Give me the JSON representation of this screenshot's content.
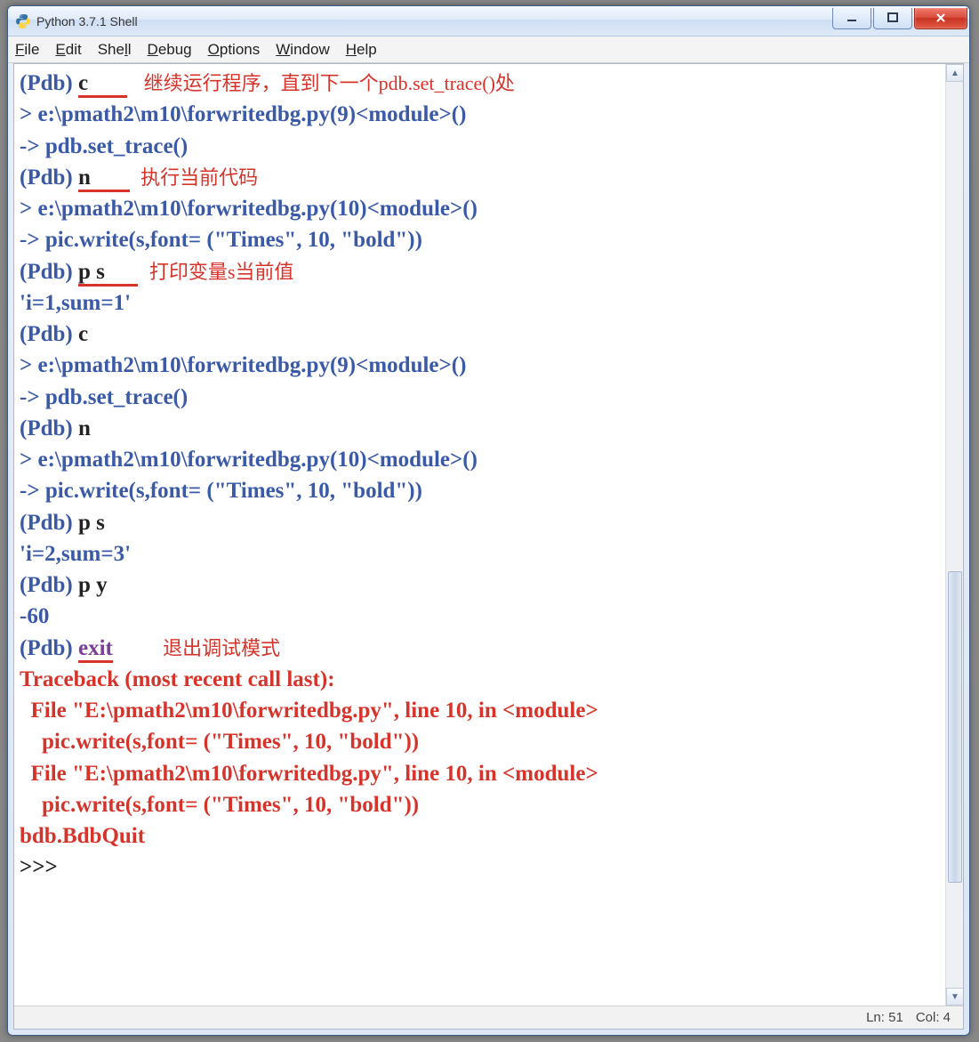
{
  "window": {
    "title": "Python 3.7.1 Shell"
  },
  "menu": {
    "file": "File",
    "edit": "Edit",
    "shell": "Shell",
    "debug": "Debug",
    "options": "Options",
    "window": "Window",
    "help": "Help"
  },
  "annotations": {
    "c": "继续运行程序，直到下一个pdb.set_trace()处",
    "n": "执行当前代码",
    "ps": "打印变量s当前值",
    "exit": "退出调试模式"
  },
  "session": {
    "prompt": "(Pdb) ",
    "repl_prompt": ">>> ",
    "cmd_c": "c",
    "cmd_n": "n",
    "cmd_ps": "p s",
    "cmd_py": "p y",
    "cmd_exit": "exit",
    "loc9": "> e:\\pmath2\\m10\\forwritedbg.py(9)<module>()",
    "arrow_set_trace": "-> pdb.set_trace()",
    "loc10": "> e:\\pmath2\\m10\\forwritedbg.py(10)<module>()",
    "arrow_write": "-> pic.write(s,font= (\"Times\", 10, \"bold\"))",
    "val_s1": "'i=1,sum=1'",
    "val_s2": "'i=2,sum=3'",
    "val_y": "-60",
    "tb_header": "Traceback (most recent call last):",
    "tb_file": "  File \"E:\\pmath2\\m10\\forwritedbg.py\", line 10, in <module>",
    "tb_line": "    pic.write(s,font= (\"Times\", 10, \"bold\"))",
    "tb_quit": "bdb.BdbQuit"
  },
  "status": {
    "ln_label": "Ln: 51",
    "col_label": "Col: 4"
  }
}
